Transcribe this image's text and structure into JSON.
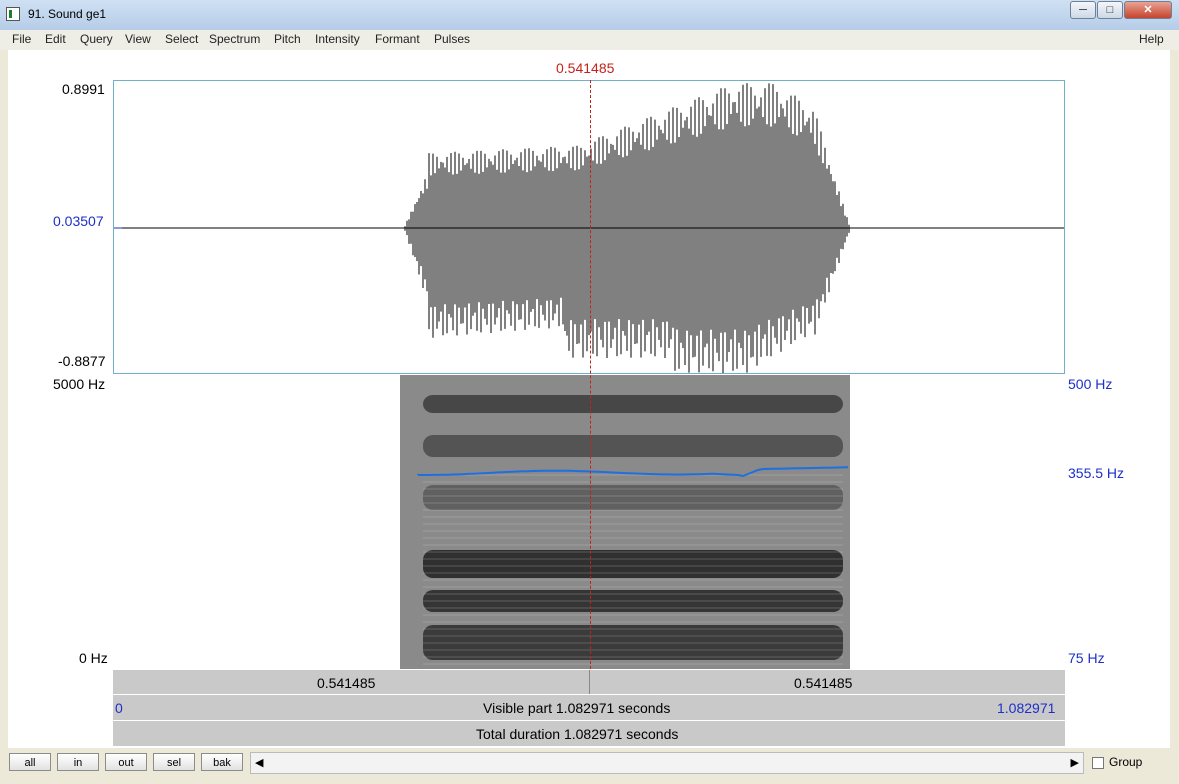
{
  "window": {
    "title": "91. Sound ge1",
    "min_icon": "minimize-icon",
    "max_icon": "maximize-icon",
    "close_icon": "close-icon"
  },
  "menu": {
    "items": [
      "File",
      "Edit",
      "Query",
      "View",
      "Select",
      "Spectrum",
      "Pitch",
      "Intensity",
      "Formant",
      "Pulses"
    ],
    "help": "Help"
  },
  "cursor": {
    "time_label": "0.541485"
  },
  "waveform": {
    "y_max": "0.8991",
    "y_mid": "0.03507",
    "y_min": "-0.8877"
  },
  "spectrogram": {
    "freq_max": "5000 Hz",
    "freq_min": "0 Hz"
  },
  "pitch": {
    "max_label": "500 Hz",
    "current_label": "355.5 Hz",
    "min_label": "75 Hz",
    "color": "#1e6fe0"
  },
  "time_rows": {
    "left_segment": "0.541485",
    "right_segment": "0.541485",
    "visible_start": "0",
    "visible_part": "Visible part 1.082971 seconds",
    "visible_end": "1.082971",
    "total_duration": "Total duration 1.082971 seconds"
  },
  "nav": {
    "all": "all",
    "in": "in",
    "out": "out",
    "sel": "sel",
    "bak": "bak",
    "group": "Group"
  }
}
